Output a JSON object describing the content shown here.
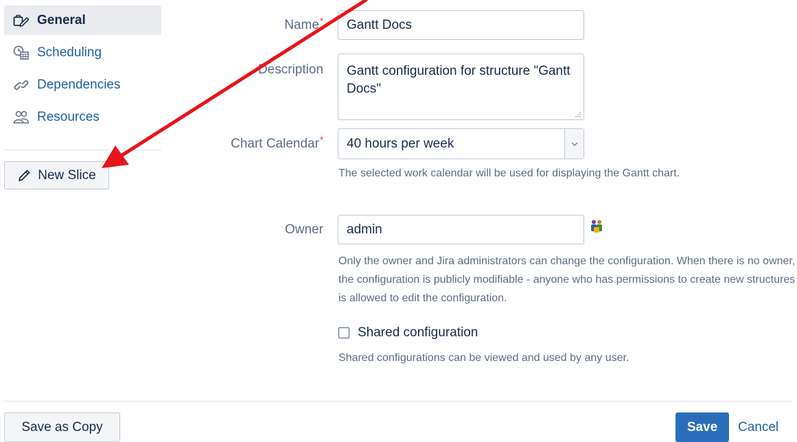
{
  "sidebar": {
    "items": [
      {
        "label": "General",
        "icon": "edit-settings-icon",
        "active": true
      },
      {
        "label": "Scheduling",
        "icon": "calendar-clock-icon",
        "active": false
      },
      {
        "label": "Dependencies",
        "icon": "link-icon",
        "active": false
      },
      {
        "label": "Resources",
        "icon": "users-icon",
        "active": false
      }
    ],
    "new_slice_label": "New Slice"
  },
  "form": {
    "name_label": "Name",
    "name_value": "Gantt Docs",
    "description_label": "Description",
    "description_value": "Gantt configuration for structure \"Gantt Docs\"",
    "calendar_label": "Chart Calendar",
    "calendar_value": "40 hours per week",
    "calendar_help": "The selected work calendar will be used for displaying the Gantt chart.",
    "owner_label": "Owner",
    "owner_value": "admin",
    "owner_help": "Only the owner and Jira administrators can change the configuration. When there is no owner, the configuration is publicly modifiable - anyone who has permissions to create new structures is allowed to edit the configuration.",
    "shared_label": "Shared configuration",
    "shared_checked": false,
    "shared_help": "Shared configurations can be viewed and used by any user.",
    "required_mark": "*"
  },
  "footer": {
    "save_as_copy_label": "Save as Copy",
    "save_label": "Save",
    "cancel_label": "Cancel"
  },
  "colors": {
    "link": "#1f5f9f",
    "primary": "#2a6ebb",
    "required": "#de350b",
    "annotation_arrow": "#e8141b"
  }
}
